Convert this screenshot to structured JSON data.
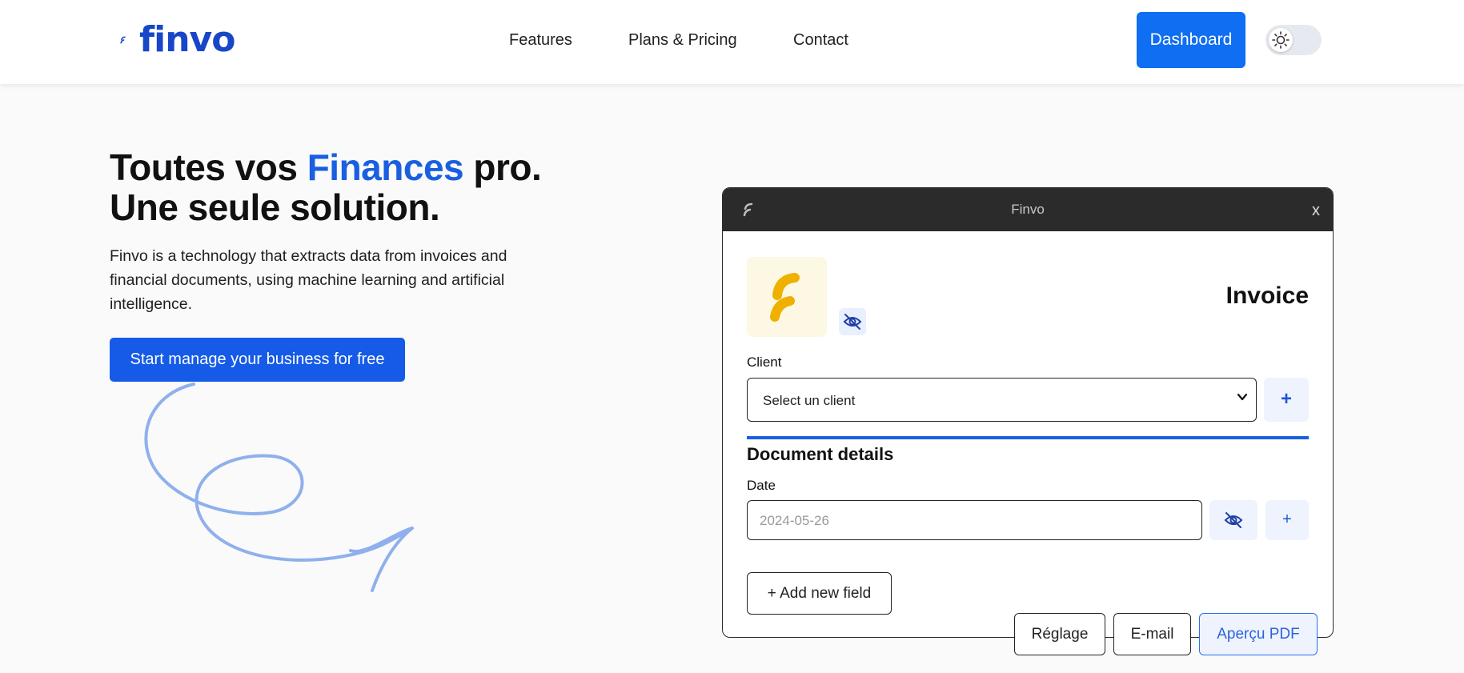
{
  "brand": {
    "name": "finvo",
    "color": "#1746c9",
    "accent_color": "#0f6ef2"
  },
  "header": {
    "nav": [
      {
        "label": "Features"
      },
      {
        "label": "Plans & Pricing"
      },
      {
        "label": "Contact"
      }
    ],
    "dashboard_label": "Dashboard",
    "theme_toggle_icon": "sun-icon"
  },
  "hero": {
    "title_line1_before": "Toutes vos ",
    "title_line1_accent": "Finances",
    "title_line1_after": " pro.",
    "title_line2": "Une seule solution.",
    "description": "Finvo is a technology that extracts data from invoices and financial documents, using machine learning and artificial intelligence.",
    "cta_label": "Start manage your business for free"
  },
  "app_window": {
    "title": "Finvo",
    "close_label": "x",
    "doc_type": "Invoice",
    "client_label": "Client",
    "client_select": {
      "value": "Select un client",
      "options": [
        "Select un client"
      ]
    },
    "add_client_label": "+",
    "section_title": "Document details",
    "date_label": "Date",
    "date_placeholder": "2024-05-26",
    "add_date_label": "+",
    "add_field_label": "+ Add new field"
  },
  "footer_actions": {
    "settings_label": "Réglage",
    "email_label": "E-mail",
    "preview_label": "Aperçu PDF"
  }
}
